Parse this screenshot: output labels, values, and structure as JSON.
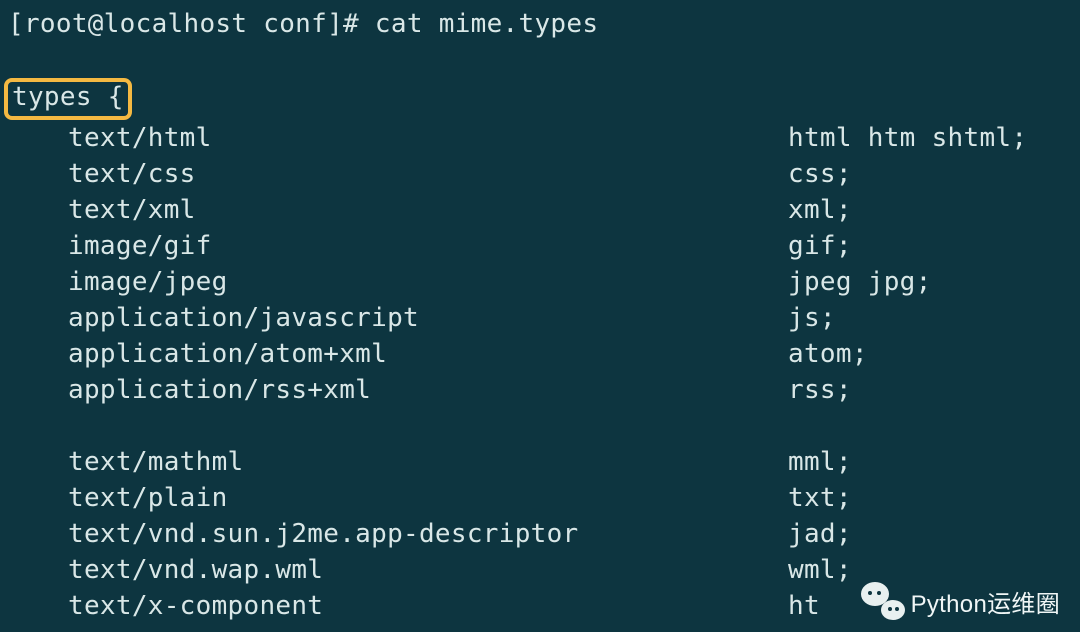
{
  "prompt": "[root@localhost conf]# cat mime.types",
  "types_open": "types {",
  "entries_block1": [
    {
      "mime": "text/html",
      "exts": "html htm shtml;"
    },
    {
      "mime": "text/css",
      "exts": "css;"
    },
    {
      "mime": "text/xml",
      "exts": "xml;"
    },
    {
      "mime": "image/gif",
      "exts": "gif;"
    },
    {
      "mime": "image/jpeg",
      "exts": "jpeg jpg;"
    },
    {
      "mime": "application/javascript",
      "exts": "js;"
    },
    {
      "mime": "application/atom+xml",
      "exts": "atom;"
    },
    {
      "mime": "application/rss+xml",
      "exts": "rss;"
    }
  ],
  "entries_block2": [
    {
      "mime": "text/mathml",
      "exts": "mml;"
    },
    {
      "mime": "text/plain",
      "exts": "txt;"
    },
    {
      "mime": "text/vnd.sun.j2me.app-descriptor",
      "exts": "jad;"
    },
    {
      "mime": "text/vnd.wap.wml",
      "exts": "wml;"
    },
    {
      "mime": "text/x-component",
      "exts": "ht"
    }
  ],
  "watermark_text": "Python运维圈"
}
